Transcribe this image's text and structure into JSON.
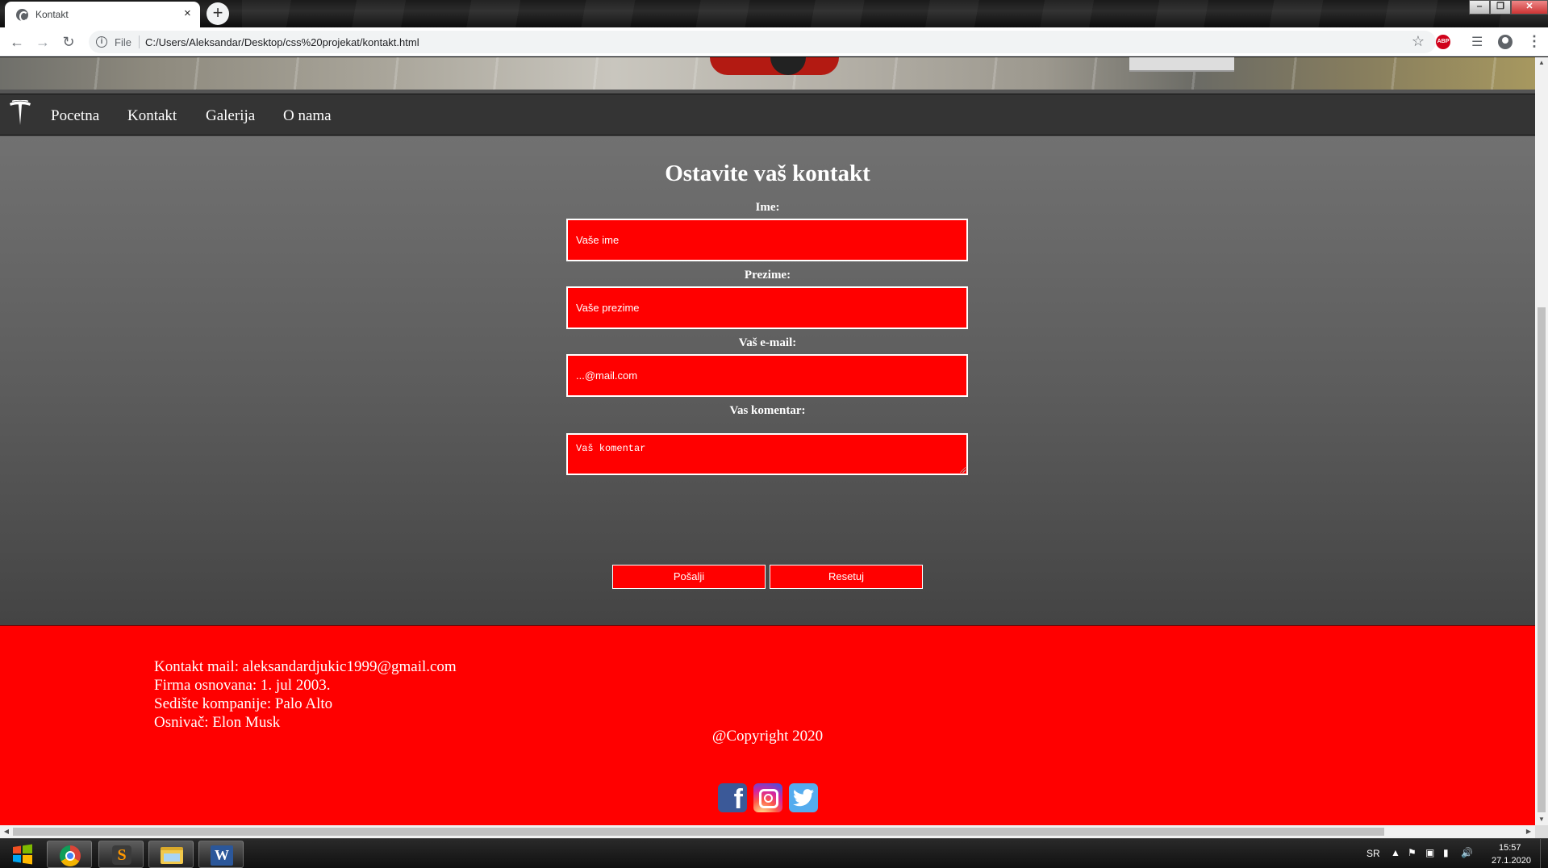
{
  "browser": {
    "tab_title": "Kontakt",
    "tab_close": "×",
    "new_tab": "+",
    "scheme": "File",
    "url": "C:/Users/Aleksandar/Desktop/css%20projekat/kontakt.html",
    "abp_badge": "ABP",
    "window_controls": {
      "minimize": "‒",
      "restore": "❐",
      "close": "✕"
    }
  },
  "navbar": {
    "links": [
      "Pocetna",
      "Kontakt",
      "Galerija",
      "O nama"
    ]
  },
  "form": {
    "title": "Ostavite vaš kontakt",
    "labels": {
      "ime": "Ime:",
      "prezime": "Prezime:",
      "email": "Vaš e-mail:",
      "komentar": "Vas komentar:"
    },
    "placeholders": {
      "ime": "Vaše ime",
      "prezime": "Vaše prezime",
      "email": "...@mail.com",
      "komentar": "Vaš komentar"
    },
    "buttons": {
      "submit": "Pošalji",
      "reset": "Resetuj"
    }
  },
  "footer": {
    "lines": [
      "Kontakt mail: aleksandardjukic1999@gmail.com",
      "Firma osnovana: 1. jul 2003.",
      "Sedište kompanije: Palo Alto",
      "Osnivač: Elon Musk"
    ],
    "copyright": "@Copyright 2020",
    "social": [
      "facebook-icon",
      "instagram-icon",
      "twitter-icon"
    ]
  },
  "taskbar": {
    "language": "SR",
    "time": "15:57",
    "date": "27.1.2020"
  },
  "colors": {
    "accent_red": "#ff0000",
    "navbar_bg": "#343434",
    "text": "#ffffff"
  }
}
